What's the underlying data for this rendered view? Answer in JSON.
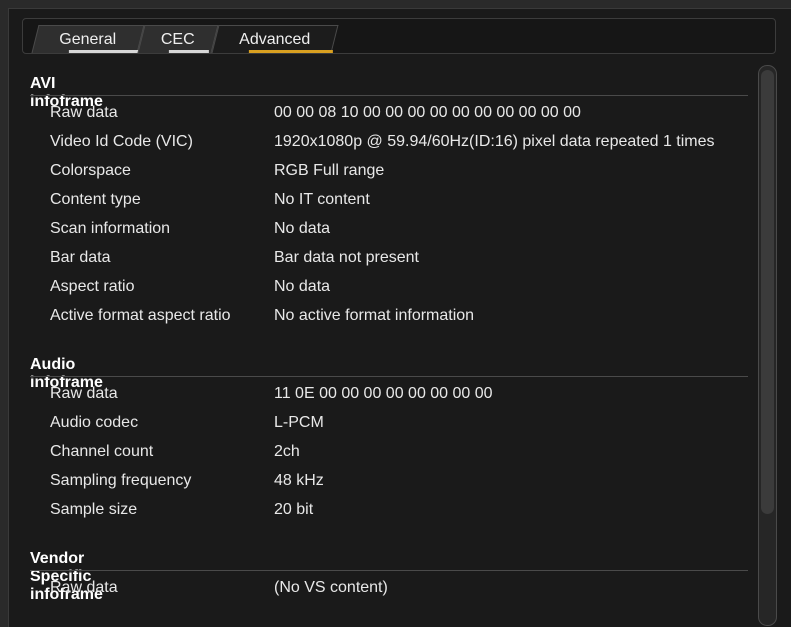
{
  "tabs": [
    {
      "label": "General",
      "active": false
    },
    {
      "label": "CEC",
      "active": false
    },
    {
      "label": "Advanced",
      "active": true
    }
  ],
  "colors": {
    "accent": "#d9a020",
    "tab_underline": "#d8d8d8",
    "background": "#1a1a1a"
  },
  "sections": [
    {
      "title": "AVI infoframe",
      "rows": [
        {
          "label": "Raw data",
          "value": "00 00 08 10 00 00 00 00 00 00 00 00 00 00"
        },
        {
          "label": "Video Id Code (VIC)",
          "value": "1920x1080p @ 59.94/60Hz(ID:16) pixel data repeated 1 times"
        },
        {
          "label": "Colorspace",
          "value": "RGB Full range"
        },
        {
          "label": "Content type",
          "value": "No IT content"
        },
        {
          "label": "Scan information",
          "value": "No data"
        },
        {
          "label": "Bar data",
          "value": "Bar data not present"
        },
        {
          "label": "Aspect ratio",
          "value": "No data"
        },
        {
          "label": "Active format aspect ratio",
          "value": "No active format information"
        }
      ]
    },
    {
      "title": "Audio infoframe",
      "rows": [
        {
          "label": "Raw data",
          "value": "11 0E 00 00 00 00 00 00 00 00"
        },
        {
          "label": "Audio codec",
          "value": "L-PCM"
        },
        {
          "label": "Channel count",
          "value": "2ch"
        },
        {
          "label": "Sampling frequency",
          "value": "48 kHz"
        },
        {
          "label": "Sample size",
          "value": "20 bit"
        }
      ]
    },
    {
      "title": "Vendor Specific infoframe",
      "rows": [
        {
          "label": "Raw data",
          "value": "(No VS content)"
        }
      ]
    }
  ]
}
